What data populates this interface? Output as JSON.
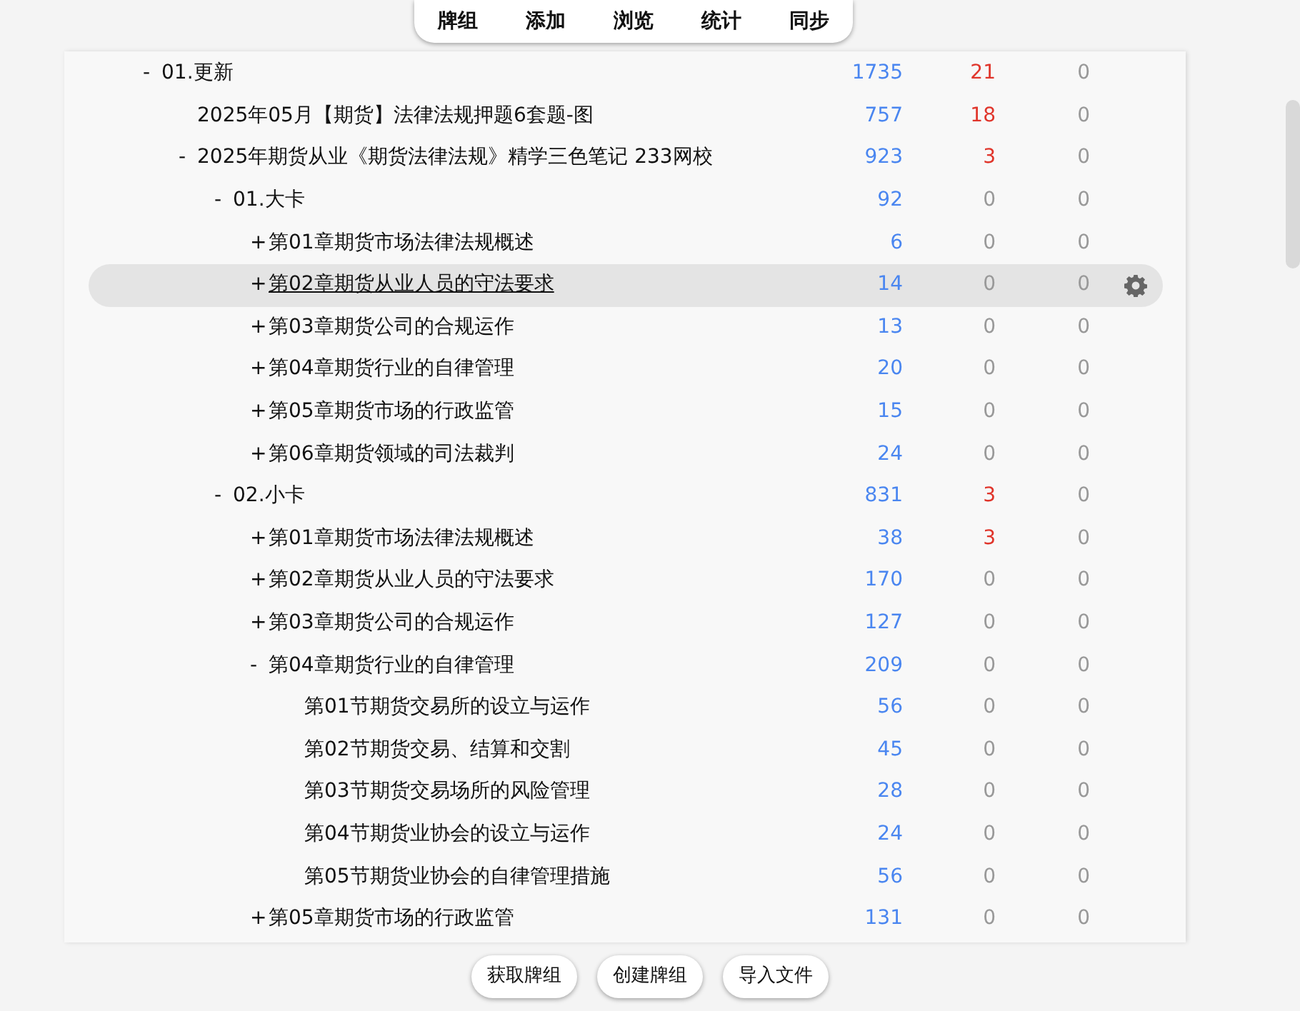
{
  "toolbar": {
    "links": [
      "牌组",
      "添加",
      "浏览",
      "统计",
      "同步"
    ]
  },
  "decks": [
    {
      "toggle": "-",
      "name": "01.更新",
      "new": "1735",
      "learn": "21",
      "due": "0",
      "selected": false,
      "children": [
        {
          "name": "2025年05月【期货】法律法规押题6套题-图",
          "new": "757",
          "learn": "18",
          "due": "0",
          "selected": false
        },
        {
          "toggle": "-",
          "name": "2025年期货从业《期货法律法规》精学三色笔记 233网校",
          "new": "923",
          "learn": "3",
          "due": "0",
          "selected": false,
          "children": [
            {
              "toggle": "-",
              "name": "01.大卡",
              "new": "92",
              "learn": "0",
              "due": "0",
              "selected": false,
              "children": [
                {
                  "toggle": "+",
                  "name": "第01章期货市场法律法规概述",
                  "new": "6",
                  "learn": "0",
                  "due": "0",
                  "selected": false
                },
                {
                  "toggle": "+",
                  "name": "第02章期货从业人员的守法要求",
                  "new": "14",
                  "learn": "0",
                  "due": "0",
                  "selected": true
                },
                {
                  "toggle": "+",
                  "name": "第03章期货公司的合规运作",
                  "new": "13",
                  "learn": "0",
                  "due": "0",
                  "selected": false
                },
                {
                  "toggle": "+",
                  "name": "第04章期货行业的自律管理",
                  "new": "20",
                  "learn": "0",
                  "due": "0",
                  "selected": false
                },
                {
                  "toggle": "+",
                  "name": "第05章期货市场的行政监管",
                  "new": "15",
                  "learn": "0",
                  "due": "0",
                  "selected": false
                },
                {
                  "toggle": "+",
                  "name": "第06章期货领域的司法裁判",
                  "new": "24",
                  "learn": "0",
                  "due": "0",
                  "selected": false
                }
              ]
            },
            {
              "toggle": "-",
              "name": "02.小卡",
              "new": "831",
              "learn": "3",
              "due": "0",
              "selected": false,
              "children": [
                {
                  "toggle": "+",
                  "name": "第01章期货市场法律法规概述",
                  "new": "38",
                  "learn": "3",
                  "due": "0",
                  "selected": false
                },
                {
                  "toggle": "+",
                  "name": "第02章期货从业人员的守法要求",
                  "new": "170",
                  "learn": "0",
                  "due": "0",
                  "selected": false
                },
                {
                  "toggle": "+",
                  "name": "第03章期货公司的合规运作",
                  "new": "127",
                  "learn": "0",
                  "due": "0",
                  "selected": false
                },
                {
                  "toggle": "-",
                  "name": "第04章期货行业的自律管理",
                  "new": "209",
                  "learn": "0",
                  "due": "0",
                  "selected": false,
                  "children": [
                    {
                      "name": "第01节期货交易所的设立与运作",
                      "new": "56",
                      "learn": "0",
                      "due": "0",
                      "selected": false
                    },
                    {
                      "name": "第02节期货交易、结算和交割",
                      "new": "45",
                      "learn": "0",
                      "due": "0",
                      "selected": false
                    },
                    {
                      "name": "第03节期货交易场所的风险管理",
                      "new": "28",
                      "learn": "0",
                      "due": "0",
                      "selected": false
                    },
                    {
                      "name": "第04节期货业协会的设立与运作",
                      "new": "24",
                      "learn": "0",
                      "due": "0",
                      "selected": false
                    },
                    {
                      "name": "第05节期货业协会的自律管理措施",
                      "new": "56",
                      "learn": "0",
                      "due": "0",
                      "selected": false
                    }
                  ]
                },
                {
                  "toggle": "+",
                  "name": "第05章期货市场的行政监管",
                  "new": "131",
                  "learn": "0",
                  "due": "0",
                  "selected": false
                }
              ]
            }
          ]
        }
      ]
    }
  ],
  "buttons": [
    "获取牌组",
    "创建牌组",
    "导入文件"
  ]
}
